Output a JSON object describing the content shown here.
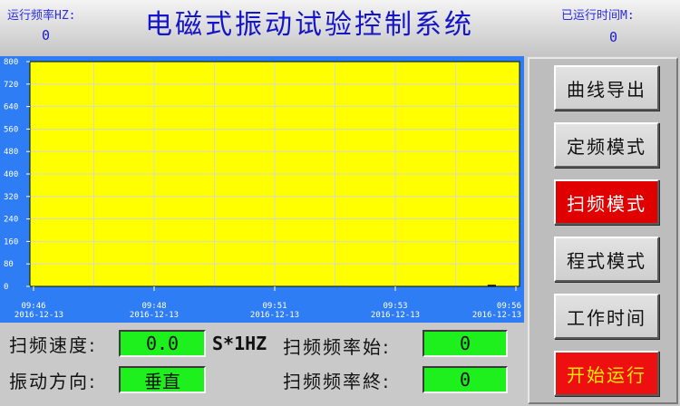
{
  "header": {
    "freq_label": "运行频率HZ:",
    "freq_value": "0",
    "title": "电磁式振动试验控制系统",
    "time_label": "已运行时间M:",
    "time_value": "0"
  },
  "chart_data": {
    "type": "line",
    "y_ticks": [
      "800",
      "720",
      "640",
      "560",
      "480",
      "400",
      "320",
      "240",
      "160",
      "80",
      "0"
    ],
    "ylim": [
      0,
      800
    ],
    "x_ticks": [
      {
        "time": "09:46",
        "date": "2016-12-13"
      },
      {
        "time": "09:48",
        "date": "2016-12-13"
      },
      {
        "time": "09:51",
        "date": "2016-12-13"
      },
      {
        "time": "09:53",
        "date": "2016-12-13"
      },
      {
        "time": "09:56",
        "date": "2016-12-13"
      }
    ],
    "series": [
      {
        "values": [
          0,
          0
        ],
        "x_range": [
          "09:55",
          "09:56"
        ],
        "color": "#111111"
      }
    ],
    "grid": true,
    "plot_background": "#ffff00",
    "panel_background": "#2f7df4"
  },
  "buttons": {
    "curve_export": "曲线导出",
    "fixed_mode": "定频模式",
    "sweep_mode": "扫频模式",
    "program_mode": "程式模式",
    "work_time": "工作时间",
    "start_run": "开始运行"
  },
  "fields": {
    "sweep_speed_label": "扫频速度:",
    "sweep_speed_value": "0.0",
    "sweep_speed_unit": "S*1HZ",
    "direction_label": "振动方向:",
    "direction_value": "垂直",
    "sweep_start_label": "扫频频率始:",
    "sweep_start_value": "0",
    "sweep_end_label": "扫频频率終:",
    "sweep_end_value": "0"
  },
  "colors": {
    "active_button": "#e00000",
    "start_button_text": "#ffe800",
    "value_box": "#1ef01e",
    "title_text": "#1414c8"
  }
}
